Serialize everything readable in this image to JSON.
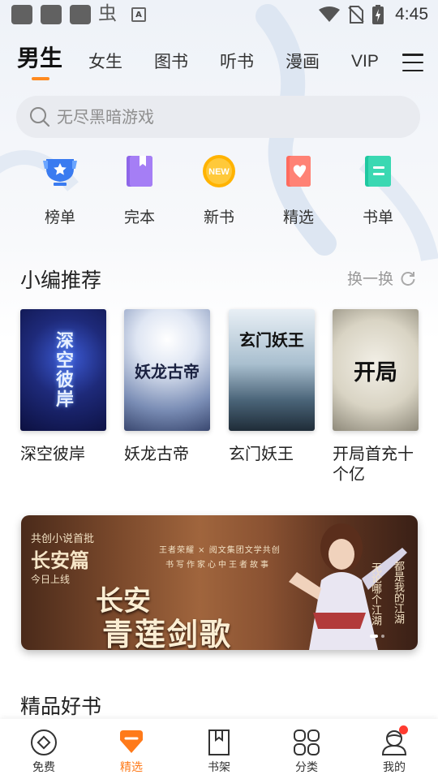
{
  "status_bar": {
    "time": "4:45",
    "icons": [
      "app-icon",
      "app-icon",
      "app-icon",
      "bug-icon",
      "a-icon",
      "wifi-icon",
      "no-sim-icon",
      "battery-charging-icon"
    ]
  },
  "top_tabs": [
    {
      "label": "男生",
      "active": true
    },
    {
      "label": "女生"
    },
    {
      "label": "图书"
    },
    {
      "label": "听书"
    },
    {
      "label": "漫画"
    },
    {
      "label": "VIP"
    }
  ],
  "search": {
    "placeholder": "无尽黑暗游戏"
  },
  "categories": [
    {
      "label": "榜单",
      "icon": "trophy-icon"
    },
    {
      "label": "完本",
      "icon": "finished-book-icon"
    },
    {
      "label": "新书",
      "icon": "new-badge-icon",
      "badge": "NEW"
    },
    {
      "label": "精选",
      "icon": "heart-card-icon"
    },
    {
      "label": "书单",
      "icon": "booklist-icon"
    }
  ],
  "editor_picks": {
    "title": "小编推荐",
    "refresh_label": "换一换",
    "books": [
      {
        "title": "深空彼岸",
        "cover_text": "深空彼岸"
      },
      {
        "title": "妖龙古帝",
        "cover_text": "妖龙古帝"
      },
      {
        "title": "玄门妖王",
        "cover_text": "玄门妖王"
      },
      {
        "title": "开局首充十个亿",
        "cover_text": "开局"
      }
    ]
  },
  "banner": {
    "line1": "共创小说首批",
    "line2": "长安篇",
    "line3": "今日上线",
    "partner": "王者荣耀 × 阅文集团文学共创",
    "slogan": "书写作家心中王者故事",
    "main1": "长安",
    "main2": "青莲剑歌",
    "poem1": "无论哪个江湖",
    "poem2": "都是我的江湖"
  },
  "quality_books": {
    "title": "精品好书"
  },
  "bottom_nav": [
    {
      "label": "免费",
      "icon": "free-icon"
    },
    {
      "label": "精选",
      "icon": "featured-icon",
      "active": true
    },
    {
      "label": "书架",
      "icon": "bookshelf-icon"
    },
    {
      "label": "分类",
      "icon": "category-grid-icon"
    },
    {
      "label": "我的",
      "icon": "profile-icon",
      "has_notification": true
    }
  ],
  "colors": {
    "accent": "#ff8a1f",
    "notification": "#ff3b30"
  }
}
